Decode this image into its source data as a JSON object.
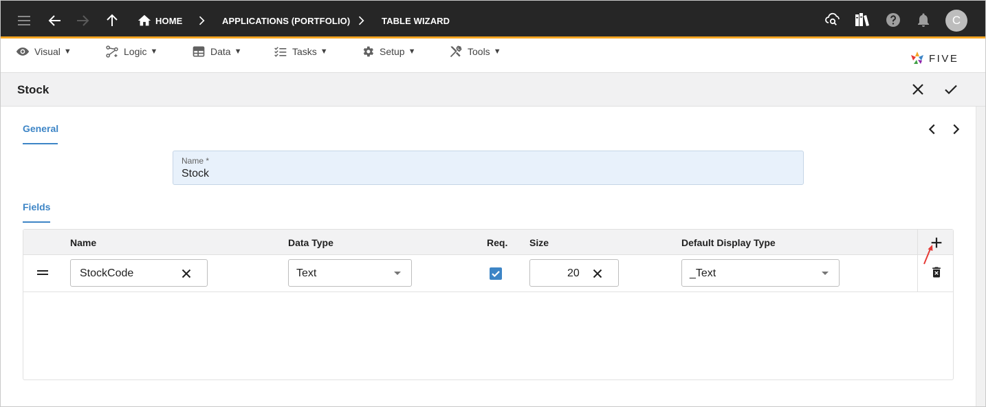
{
  "appbar": {
    "breadcrumbs": [
      "HOME",
      "APPLICATIONS (PORTFOLIO)",
      "TABLE WIZARD"
    ],
    "avatar_initial": "C",
    "icons": [
      "menu-icon",
      "back-arrow-icon",
      "forward-arrow-icon",
      "up-arrow-icon",
      "home-icon",
      "cloud-search-icon",
      "library-icon",
      "help-icon",
      "bell-icon"
    ]
  },
  "menubar": {
    "items": [
      {
        "label": "Visual",
        "icon": "eye-icon"
      },
      {
        "label": "Logic",
        "icon": "logic-icon"
      },
      {
        "label": "Data",
        "icon": "table-icon"
      },
      {
        "label": "Tasks",
        "icon": "checklist-icon"
      },
      {
        "label": "Setup",
        "icon": "gear-icon"
      },
      {
        "label": "Tools",
        "icon": "tools-icon"
      }
    ],
    "caret": "▼",
    "brand": "FIVE"
  },
  "form": {
    "title": "Stock",
    "general_tab": "General",
    "name_label": "Name *",
    "name_value": "Stock",
    "fields_tab": "Fields"
  },
  "grid": {
    "columns": [
      "Name",
      "Data Type",
      "Req.",
      "Size",
      "Default Display Type"
    ],
    "rows": [
      {
        "name": "StockCode",
        "data_type": "Text",
        "required": true,
        "size": "20",
        "display_type": "_Text"
      }
    ]
  },
  "colors": {
    "appbar_bg": "#262626",
    "accent": "#f5a623",
    "primary": "#3d85c6",
    "annotation_arrow": "#e53935"
  }
}
